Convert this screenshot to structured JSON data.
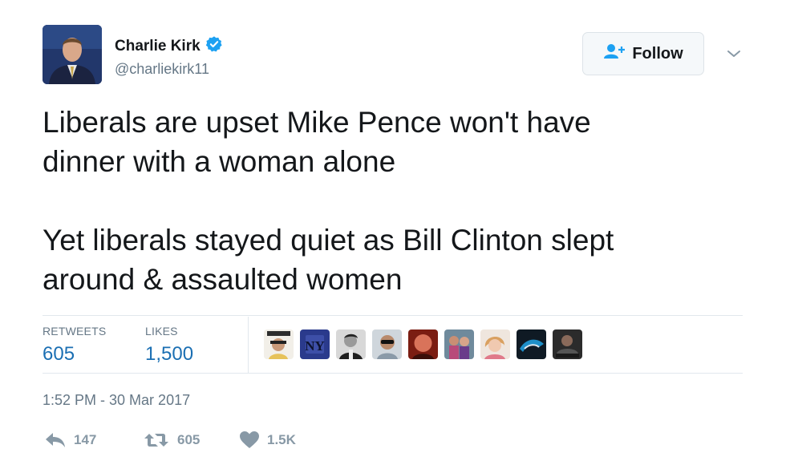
{
  "user": {
    "name": "Charlie Kirk",
    "handle": "@charliekirk11",
    "verified_icon": "verified-badge-icon",
    "avatar_icon": "profile-photo"
  },
  "follow": {
    "label": "Follow",
    "icon": "add-user-icon"
  },
  "menu": {
    "icon": "chevron-down-icon"
  },
  "tweet": {
    "text": "Liberals are upset Mike Pence won't have\ndinner with a woman alone\n\nYet liberals stayed quiet as Bill Clinton slept\naround & assaulted women"
  },
  "stats": {
    "retweets_label": "RETWEETS",
    "retweets_value": "605",
    "likes_label": "LIKES",
    "likes_value": "1,500"
  },
  "likers": [
    "liker-1",
    "liker-2",
    "liker-3",
    "liker-4",
    "liker-5",
    "liker-6",
    "liker-7",
    "liker-8",
    "liker-9"
  ],
  "timestamp": "1:52 PM - 30 Mar 2017",
  "actions": {
    "reply": {
      "icon": "reply-icon",
      "count": "147"
    },
    "retweet": {
      "icon": "retweet-icon",
      "count": "605"
    },
    "like": {
      "icon": "heart-icon",
      "count": "1.5K"
    }
  },
  "colors": {
    "verified": "#1da1f2",
    "stat_value": "#1b6fb3",
    "muted": "#657786",
    "action": "#8899a6"
  }
}
